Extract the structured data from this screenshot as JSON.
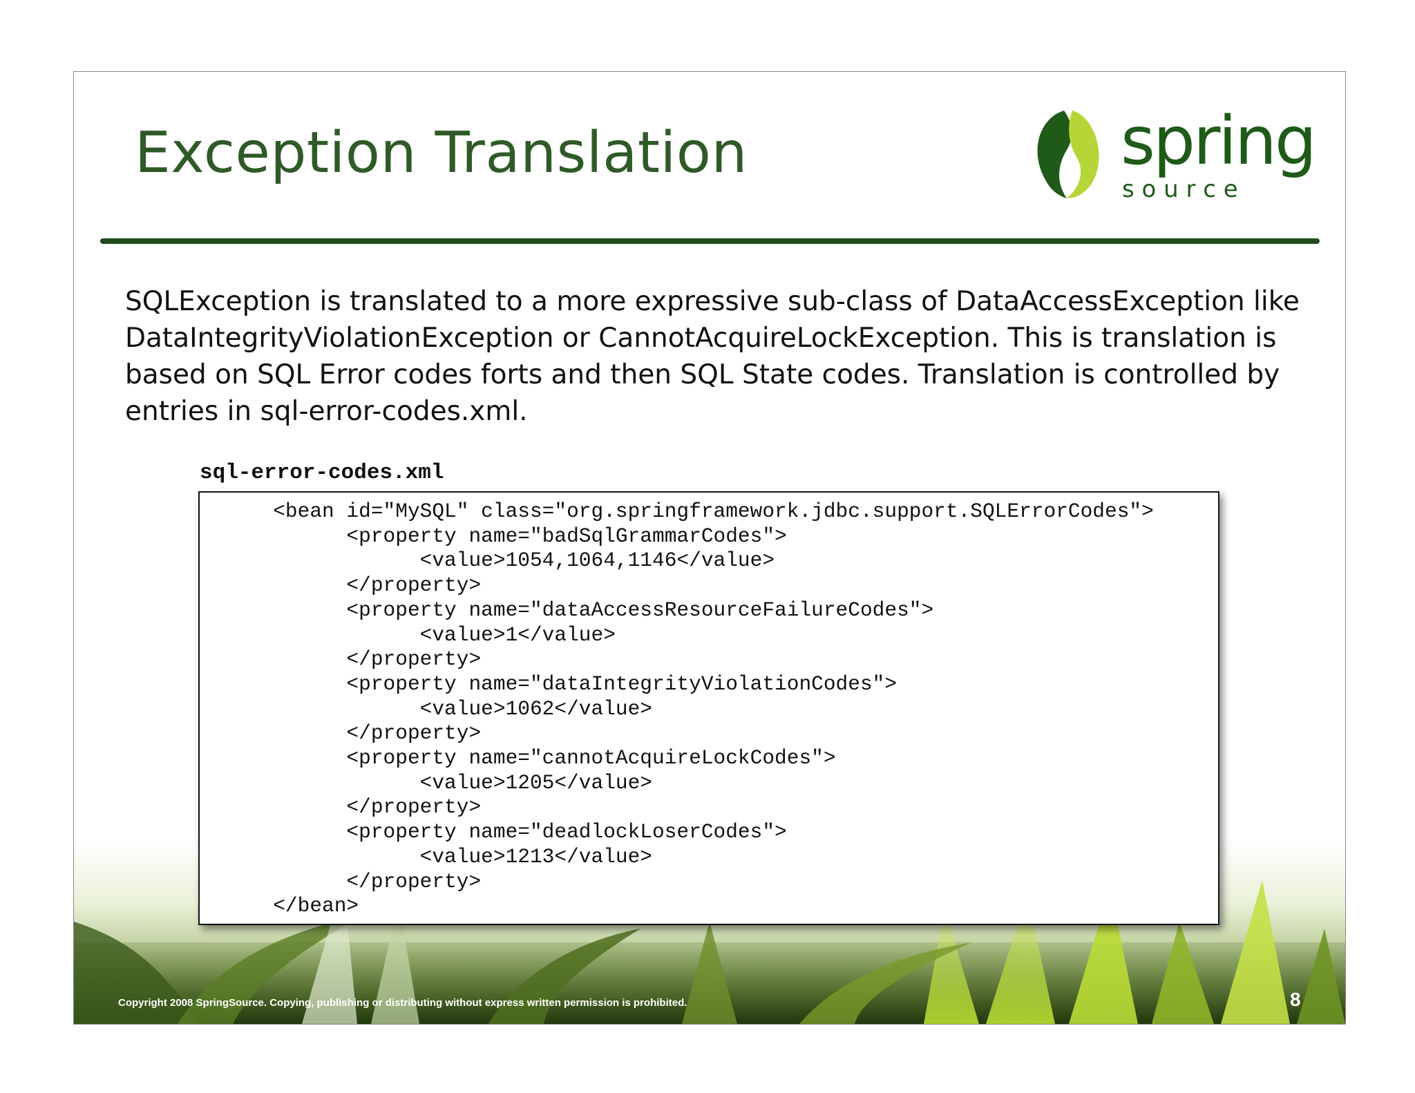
{
  "slide": {
    "title": "Exception Translation",
    "logo": {
      "word": "spring",
      "subword": "s o u r c e",
      "brand_colors": [
        "#1f5a18",
        "#b6d638"
      ]
    },
    "body_text": "SQLException is translated to a more expressive sub-class of DataAccessException like DataIntegrityViolationException or CannotAcquireLockException. This is translation is based on SQL Error codes forts and then SQL State codes.  Translation is controlled by entries in sql-error-codes.xml.",
    "code_label": "sql-error-codes.xml",
    "code_lines": [
      "      <bean id=\"MySQL\" class=\"org.springframework.jdbc.support.SQLErrorCodes\">",
      "            <property name=\"badSqlGrammarCodes\">",
      "                  <value>1054,1064,1146</value>",
      "            </property>",
      "            <property name=\"dataAccessResourceFailureCodes\">",
      "                  <value>1</value>",
      "            </property>",
      "            <property name=\"dataIntegrityViolationCodes\">",
      "                  <value>1062</value>",
      "            </property>",
      "            <property name=\"cannotAcquireLockCodes\">",
      "                  <value>1205</value>",
      "            </property>",
      "            <property name=\"deadlockLoserCodes\">",
      "                  <value>1213</value>",
      "            </property>",
      "      </bean>"
    ],
    "footer_copyright": "Copyright 2008 SpringSource.  Copying, publishing or distributing without express written permission is prohibited.",
    "page_number": "8"
  }
}
